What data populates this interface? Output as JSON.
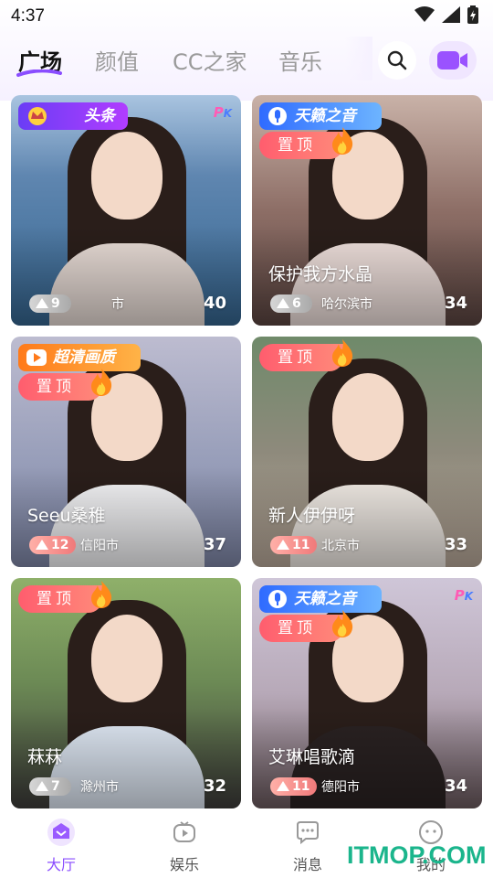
{
  "status_bar": {
    "time": "4:37"
  },
  "tabs": [
    {
      "label": "广场",
      "active": true
    },
    {
      "label": "颜值",
      "active": false
    },
    {
      "label": "CC之家",
      "active": false
    },
    {
      "label": "音乐",
      "active": false
    }
  ],
  "header": {
    "search_icon": "search-icon",
    "video_icon": "video-camera-icon"
  },
  "badges": {
    "pinned": "置顶",
    "tianlai": "天籁之音",
    "hd": "超清画质",
    "headline": "头条",
    "pk": "P",
    "pk_k": "K"
  },
  "cards": [
    {
      "title": "",
      "level": "9",
      "city": "市",
      "count": "40"
    },
    {
      "title": "保护我方水晶",
      "level": "6",
      "city": "哈尔滨市",
      "count": "34"
    },
    {
      "title": "Seeu桑稚",
      "level": "12",
      "city": "信阳市",
      "count": "37"
    },
    {
      "title": "新人伊伊呀",
      "level": "11",
      "city": "北京市",
      "count": "33"
    },
    {
      "title": "菻菻",
      "level": "7",
      "city": "滁州市",
      "count": "32"
    },
    {
      "title": "艾琳唱歌滴",
      "level": "11",
      "city": "德阳市",
      "count": "34"
    }
  ],
  "bottom_nav": [
    {
      "label": "大厅",
      "active": true
    },
    {
      "label": "娱乐",
      "active": false
    },
    {
      "label": "消息",
      "active": false
    },
    {
      "label": "我的",
      "active": false
    }
  ],
  "watermark": "ITMOP.COM",
  "colors": {
    "accent": "#8a4dff",
    "pin": "#ff5d6e",
    "watermark": "#1bb58c"
  }
}
